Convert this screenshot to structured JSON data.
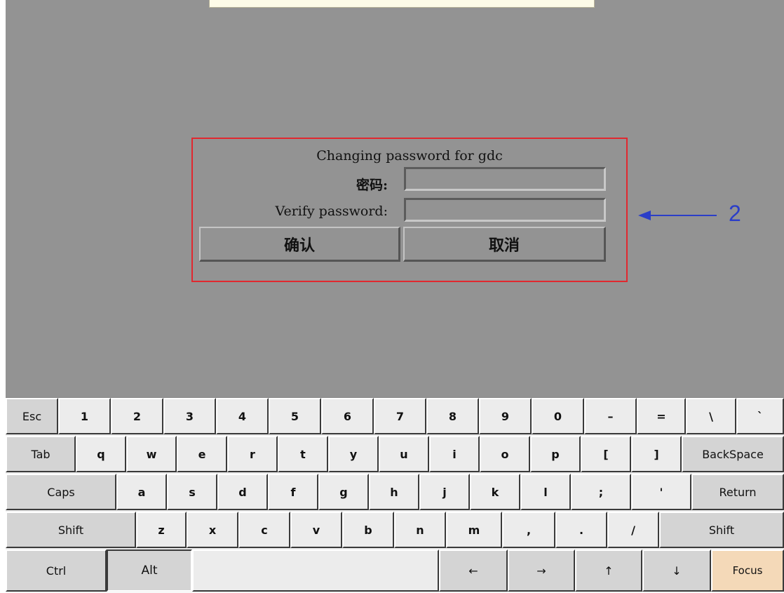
{
  "dialog": {
    "title": "Changing password for gdc",
    "password_label": "密码:",
    "verify_label": "Verify password:",
    "password_value": "",
    "verify_value": "",
    "confirm_label": "确认",
    "cancel_label": "取消"
  },
  "annotation": {
    "number": "2",
    "box_color": "#e1282f",
    "arrow_color": "#2b3ec8"
  },
  "keyboard": {
    "rows": [
      [
        "Esc",
        "1",
        "2",
        "3",
        "4",
        "5",
        "6",
        "7",
        "8",
        "9",
        "0",
        "–",
        "=",
        "\\",
        "`"
      ],
      [
        "Tab",
        "q",
        "w",
        "e",
        "r",
        "t",
        "y",
        "u",
        "i",
        "o",
        "p",
        "[",
        "]",
        "BackSpace"
      ],
      [
        "Caps",
        "a",
        "s",
        "d",
        "f",
        "g",
        "h",
        "j",
        "k",
        "l",
        ";",
        "'",
        "Return"
      ],
      [
        "Shift",
        "z",
        "x",
        "c",
        "v",
        "b",
        "n",
        "m",
        ",",
        ".",
        "/",
        "Shift"
      ],
      [
        "Ctrl",
        "Alt",
        "",
        "←",
        "→",
        "↑",
        "↓",
        "Focus"
      ]
    ]
  }
}
